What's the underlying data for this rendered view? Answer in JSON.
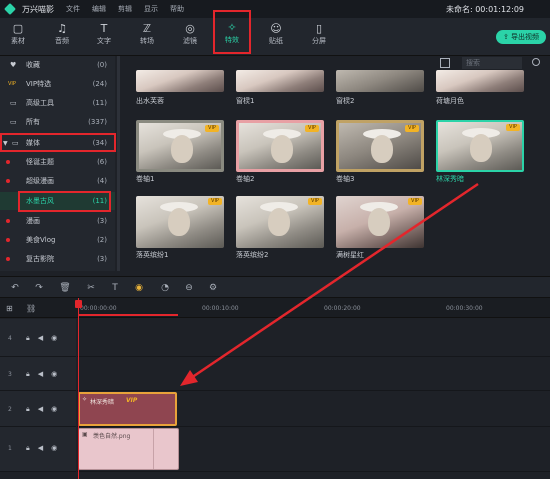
{
  "titlebar": {
    "app_name": "万兴喵影",
    "menu": [
      "文件",
      "编辑",
      "剪辑",
      "显示",
      "帮助"
    ],
    "project": "未命名: 00:01:12:09"
  },
  "toolbar": {
    "tools": [
      {
        "label": "素材",
        "icon": "folder-icon"
      },
      {
        "label": "音频",
        "icon": "music-icon"
      },
      {
        "label": "文字",
        "icon": "text-icon"
      },
      {
        "label": "转场",
        "icon": "transition-icon"
      },
      {
        "label": "滤镜",
        "icon": "filter-icon"
      },
      {
        "label": "特效",
        "icon": "effects-icon"
      },
      {
        "label": "贴纸",
        "icon": "sticker-icon"
      },
      {
        "label": "分屏",
        "icon": "splitscreen-icon"
      }
    ],
    "export_label": "导出视频"
  },
  "sidebar": {
    "items": [
      {
        "name": "收藏",
        "count": "(0)"
      },
      {
        "name": "VIP特选",
        "count": "(24)"
      },
      {
        "name": "高级工具",
        "count": "(11)"
      },
      {
        "name": "所有",
        "count": "(337)"
      },
      {
        "name": "媒体",
        "count": "(34)"
      },
      {
        "name": "怪诞主题",
        "count": "(6)"
      },
      {
        "name": "超级漫画",
        "count": "(4)"
      },
      {
        "name": "水墨古风",
        "count": "(11)"
      },
      {
        "name": "漫画",
        "count": "(3)"
      },
      {
        "name": "美食Vlog",
        "count": "(2)"
      },
      {
        "name": "复古影院",
        "count": "(3)"
      }
    ]
  },
  "library": {
    "search_placeholder": "搜索",
    "vip_badge": "VIP",
    "items": [
      {
        "label": "出水芙蓉"
      },
      {
        "label": "窗棂1"
      },
      {
        "label": "窗棂2"
      },
      {
        "label": "荷塘月色"
      },
      {
        "label": "卷轴1"
      },
      {
        "label": "卷轴2"
      },
      {
        "label": "卷轴3"
      },
      {
        "label": "林深秀暗"
      },
      {
        "label": "落英缤纷1"
      },
      {
        "label": "落英缤纷2"
      },
      {
        "label": "满树星红"
      }
    ]
  },
  "timeline": {
    "ticks": [
      "00:00:00:00",
      "00:00:10:00",
      "00:00:20:00",
      "00:00:30:00"
    ],
    "tracks": [
      "4",
      "3",
      "2",
      "1"
    ],
    "effect_clip": {
      "name": "林深秀暗",
      "vip": "VIP"
    },
    "media_clip": {
      "name": "羡色自然.png"
    }
  },
  "colors": {
    "accent": "#2bd3a8",
    "highlight": "#e3262c",
    "vip": "#f2b325"
  }
}
